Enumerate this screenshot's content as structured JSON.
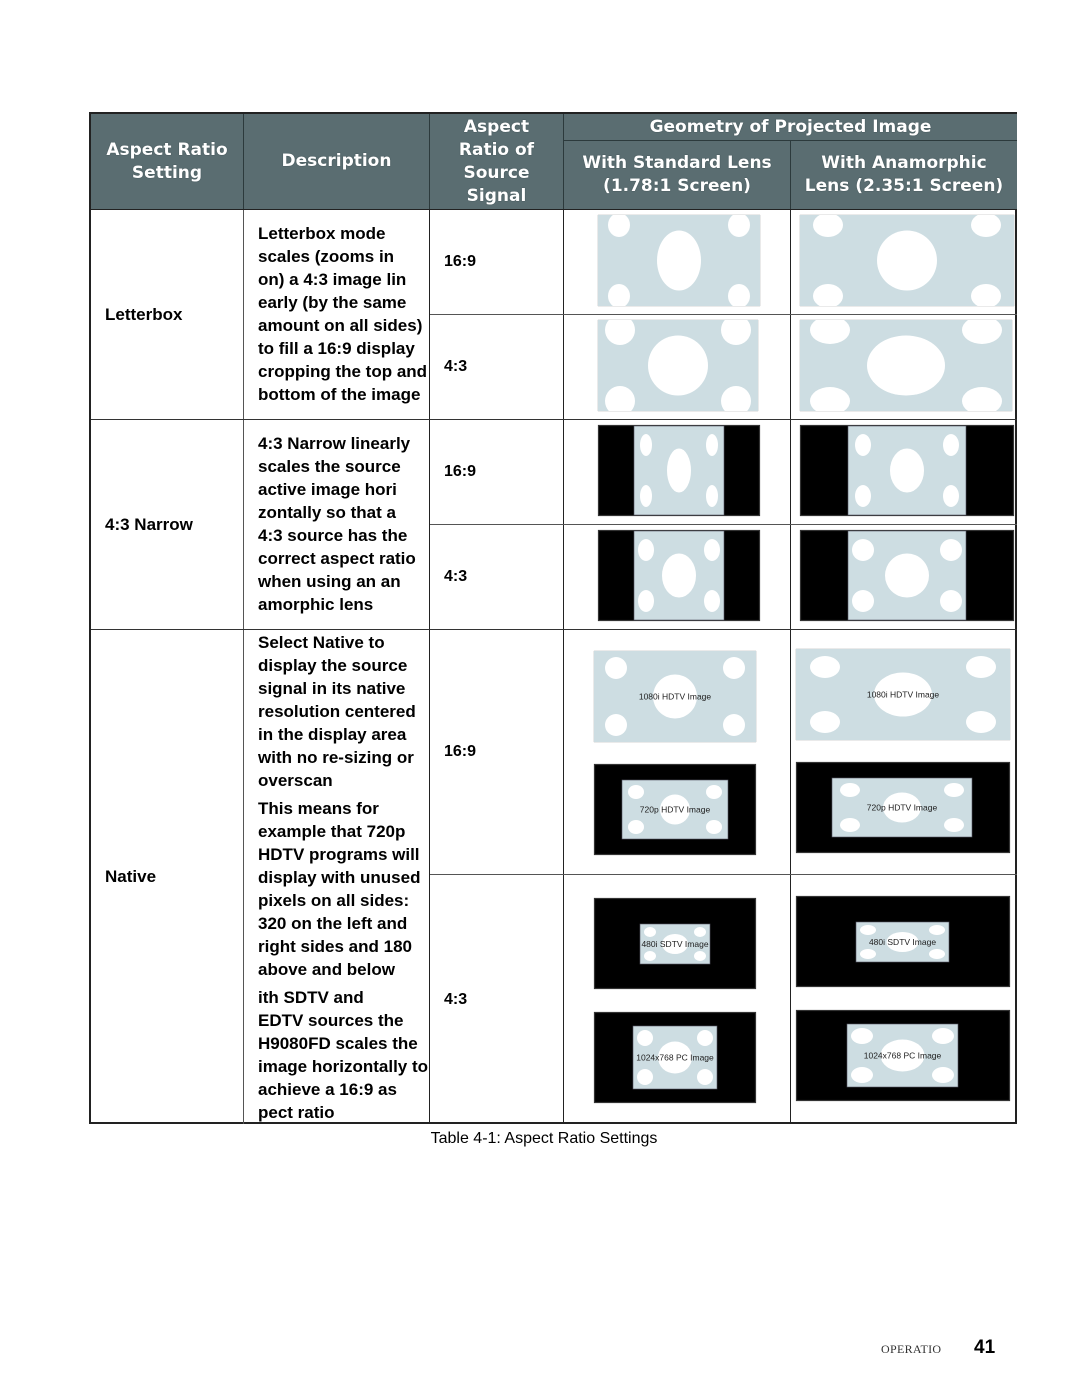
{
  "table": {
    "headers": {
      "setting": "Aspect Ratio\nSetting",
      "description": "Description",
      "source": "Aspect\nRatio of\nSource\nSignal",
      "geometry": "Geometry of Projected Image",
      "standard": "With Standard Lens\n(1.78:1 Screen)",
      "anamorphic": "With Anamorphic\nLens (2.35:1 Screen)"
    },
    "rows": [
      {
        "setting": "Letterbox",
        "description": "Letterbox mode\nscales (zooms in\non) a 4:3 image lin\nearly (by the same\namount on all sides)\nto fill a 16:9 display\ncropping the top and\nbottom of the image",
        "sources": [
          "16:9",
          "4:3"
        ]
      },
      {
        "setting": "4:3 Narrow",
        "description": "4:3 Narrow linearly\nscales the source\nactive image hori\nzontally so that a\n4:3 source has the\ncorrect aspect ratio\nwhen using an an\namorphic lens",
        "sources": [
          "16:9",
          "4:3"
        ]
      },
      {
        "setting": "Native",
        "description_1": "Select Native to\ndisplay the source\nsignal in its native\nresolution centered\nin the display area\nwith no re-sizing or\noverscan",
        "description_2": "This means for\nexample that 720p\nHDTV programs will\ndisplay with unused\npixels on all sides:\n320 on the left and\nright sides and 180\nabove and below",
        "description_3": "ith SDTV and\nEDTV sources the\nH9080FD scales the\nimage horizontally to\nachieve a 16:9 as\npect ratio",
        "sources": [
          "16:9",
          "4:3"
        ],
        "image_labels": {
          "hd1080": "1080i HDTV Image",
          "hd720": "720p HDTV Image",
          "sd480": "480i SDTV Image",
          "pc1024": "1024x768 PC Image"
        }
      }
    ]
  },
  "colors": {
    "header_bg": "#5a6d71",
    "image_fill": "#cddde2",
    "letterbox_black": "#000000"
  },
  "caption": "Table 4-1: Aspect Ratio Settings",
  "footer": {
    "section": "OPERATIO",
    "page_number": "41"
  }
}
